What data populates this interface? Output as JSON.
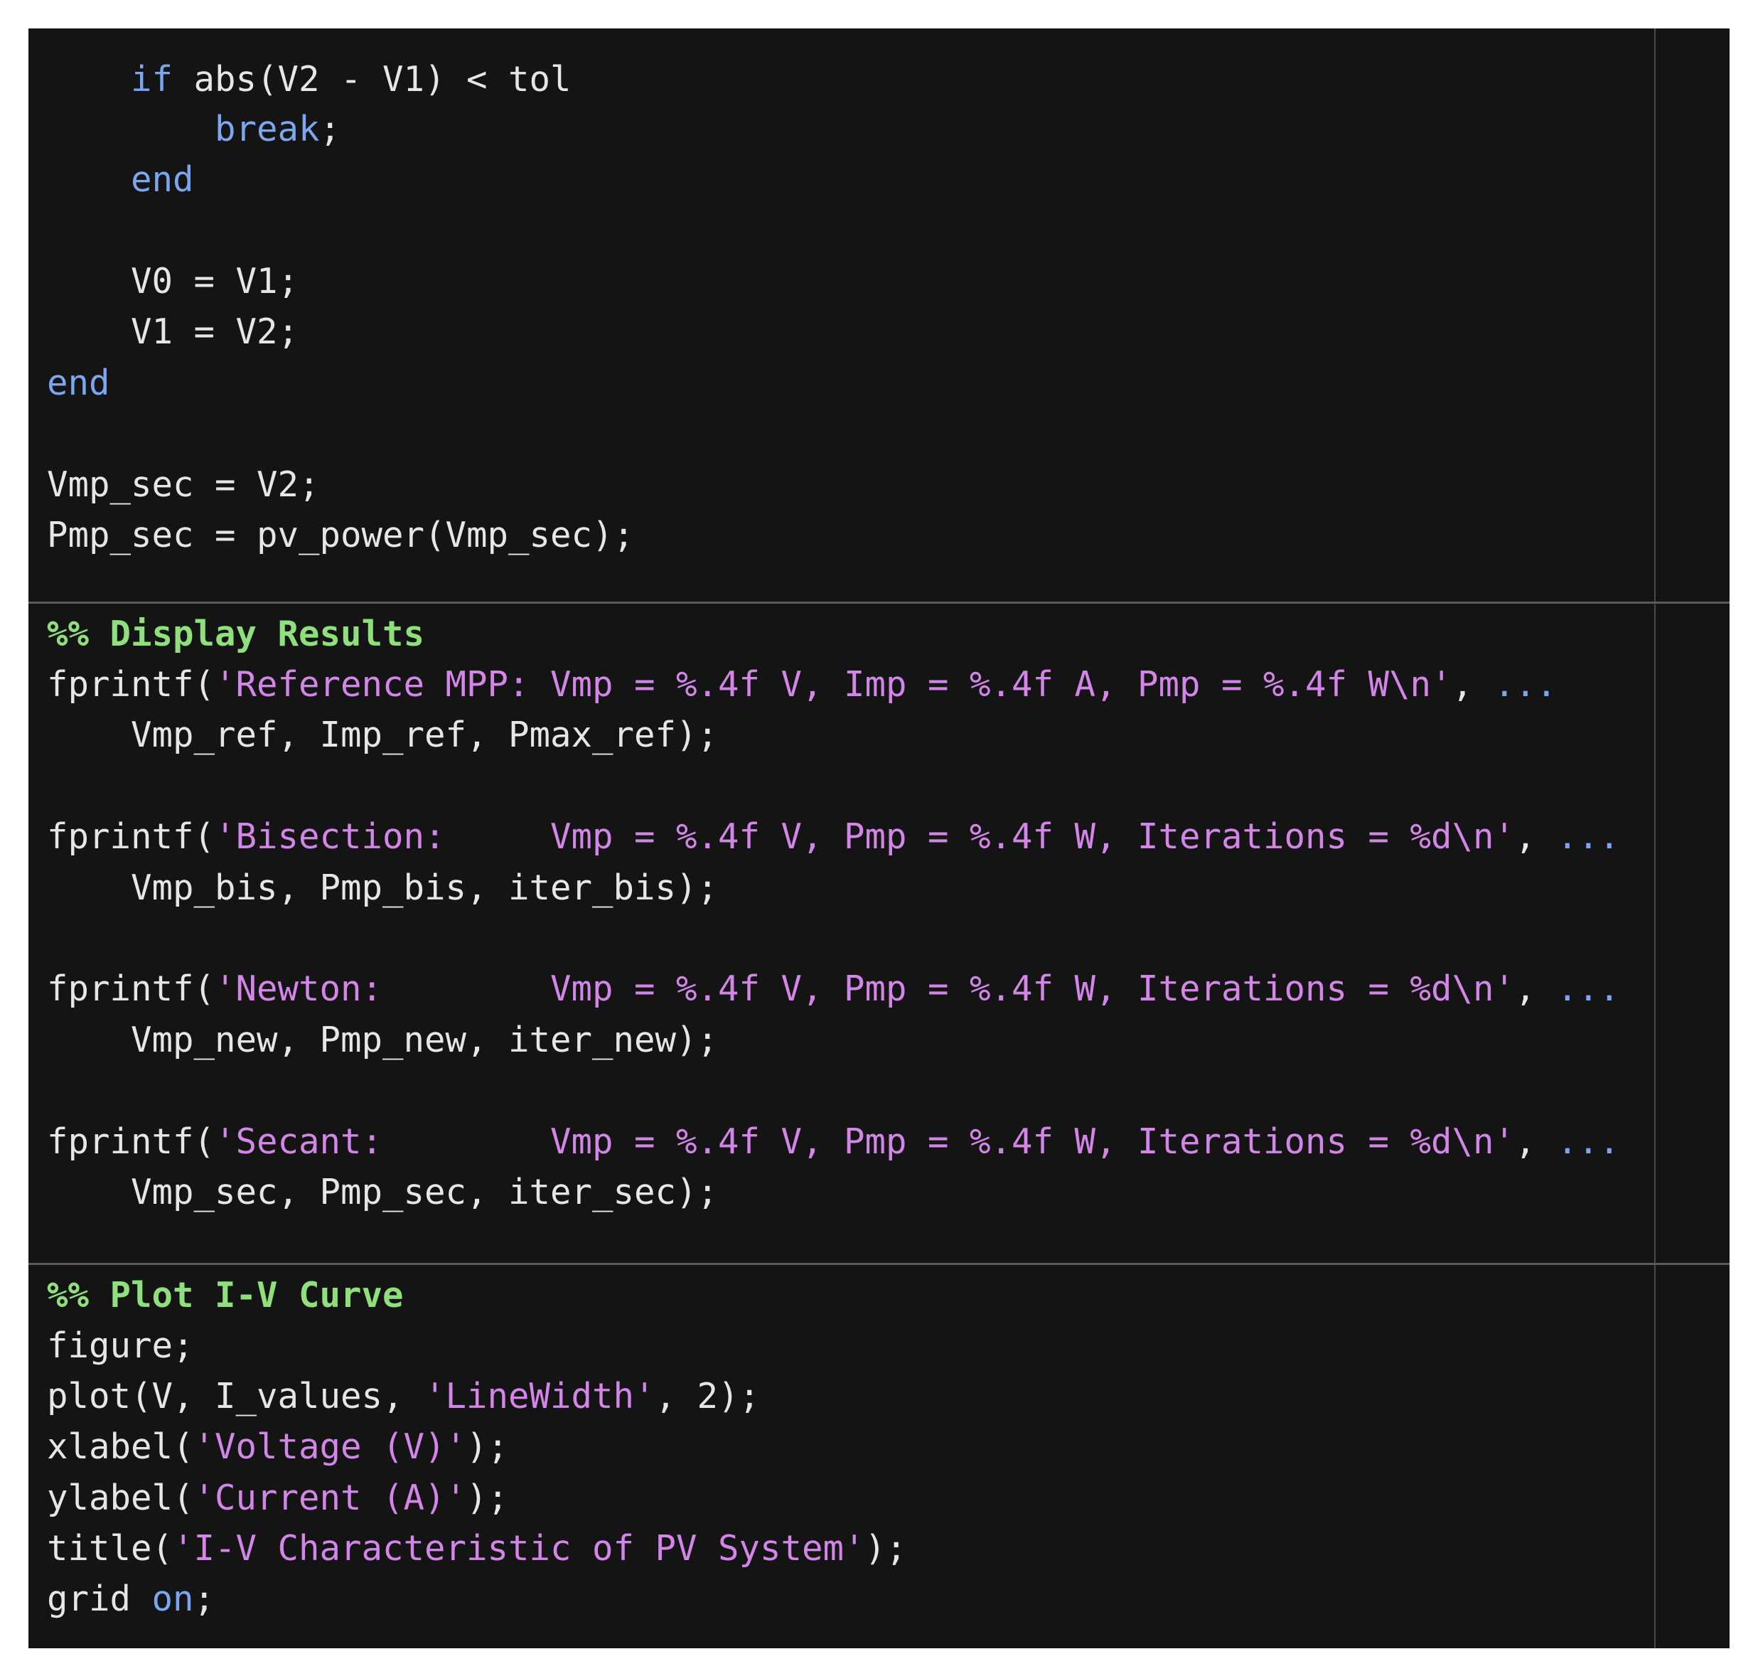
{
  "theme": {
    "background": "#141414",
    "plain": "#e6e6e6",
    "keyword": "#7aa7f0",
    "string": "#d386e8",
    "section_comment": "#8fe07c",
    "divider": "#5a5a5a"
  },
  "editor": {
    "lines": [
      [
        {
          "t": "    ",
          "c": "plain"
        },
        {
          "t": "if",
          "c": "keyword"
        },
        {
          "t": " abs(V2 - V1) < tol",
          "c": "plain"
        }
      ],
      [
        {
          "t": "        ",
          "c": "plain"
        },
        {
          "t": "break",
          "c": "keyword"
        },
        {
          "t": ";",
          "c": "plain"
        }
      ],
      [
        {
          "t": "    ",
          "c": "plain"
        },
        {
          "t": "end",
          "c": "keyword"
        }
      ],
      [],
      [
        {
          "t": "    V0 = V1;",
          "c": "plain"
        }
      ],
      [
        {
          "t": "    V1 = V2;",
          "c": "plain"
        }
      ],
      [
        {
          "t": "end",
          "c": "keyword"
        }
      ],
      [],
      [
        {
          "t": "Vmp_sec = V2;",
          "c": "plain"
        }
      ],
      [
        {
          "t": "Pmp_sec = pv_power(Vmp_sec);",
          "c": "plain"
        }
      ],
      [
        {
          "t": "%% Display Results",
          "c": "comment"
        }
      ],
      [
        {
          "t": "fprintf(",
          "c": "plain"
        },
        {
          "t": "'Reference MPP: Vmp = %.4f V, Imp = %.4f A, Pmp = %.4f W\\n'",
          "c": "string"
        },
        {
          "t": ", ",
          "c": "plain"
        },
        {
          "t": "...",
          "c": "keyword"
        }
      ],
      [
        {
          "t": "    Vmp_ref, Imp_ref, Pmax_ref);",
          "c": "plain"
        }
      ],
      [],
      [
        {
          "t": "fprintf(",
          "c": "plain"
        },
        {
          "t": "'Bisection:     Vmp = %.4f V, Pmp = %.4f W, Iterations = %d\\n'",
          "c": "string"
        },
        {
          "t": ", ",
          "c": "plain"
        },
        {
          "t": "...",
          "c": "keyword"
        }
      ],
      [
        {
          "t": "    Vmp_bis, Pmp_bis, iter_bis);",
          "c": "plain"
        }
      ],
      [],
      [
        {
          "t": "fprintf(",
          "c": "plain"
        },
        {
          "t": "'Newton:        Vmp = %.4f V, Pmp = %.4f W, Iterations = %d\\n'",
          "c": "string"
        },
        {
          "t": ", ",
          "c": "plain"
        },
        {
          "t": "...",
          "c": "keyword"
        }
      ],
      [
        {
          "t": "    Vmp_new, Pmp_new, iter_new);",
          "c": "plain"
        }
      ],
      [],
      [
        {
          "t": "fprintf(",
          "c": "plain"
        },
        {
          "t": "'Secant:        Vmp = %.4f V, Pmp = %.4f W, Iterations = %d\\n'",
          "c": "string"
        },
        {
          "t": ", ",
          "c": "plain"
        },
        {
          "t": "...",
          "c": "keyword"
        }
      ],
      [
        {
          "t": "    Vmp_sec, Pmp_sec, iter_sec);",
          "c": "plain"
        }
      ],
      [
        {
          "t": "%% Plot I-V Curve",
          "c": "comment"
        }
      ],
      [
        {
          "t": "figure;",
          "c": "plain"
        }
      ],
      [
        {
          "t": "plot(V, I_values, ",
          "c": "plain"
        },
        {
          "t": "'LineWidth'",
          "c": "string"
        },
        {
          "t": ", 2);",
          "c": "plain"
        }
      ],
      [
        {
          "t": "xlabel(",
          "c": "plain"
        },
        {
          "t": "'Voltage (V)'",
          "c": "string"
        },
        {
          "t": ");",
          "c": "plain"
        }
      ],
      [
        {
          "t": "ylabel(",
          "c": "plain"
        },
        {
          "t": "'Current (A)'",
          "c": "string"
        },
        {
          "t": ");",
          "c": "plain"
        }
      ],
      [
        {
          "t": "title(",
          "c": "plain"
        },
        {
          "t": "'I-V Characteristic of PV System'",
          "c": "string"
        },
        {
          "t": ");",
          "c": "plain"
        }
      ],
      [
        {
          "t": "grid ",
          "c": "plain"
        },
        {
          "t": "on",
          "c": "keyword"
        },
        {
          "t": ";",
          "c": "plain"
        }
      ]
    ]
  }
}
